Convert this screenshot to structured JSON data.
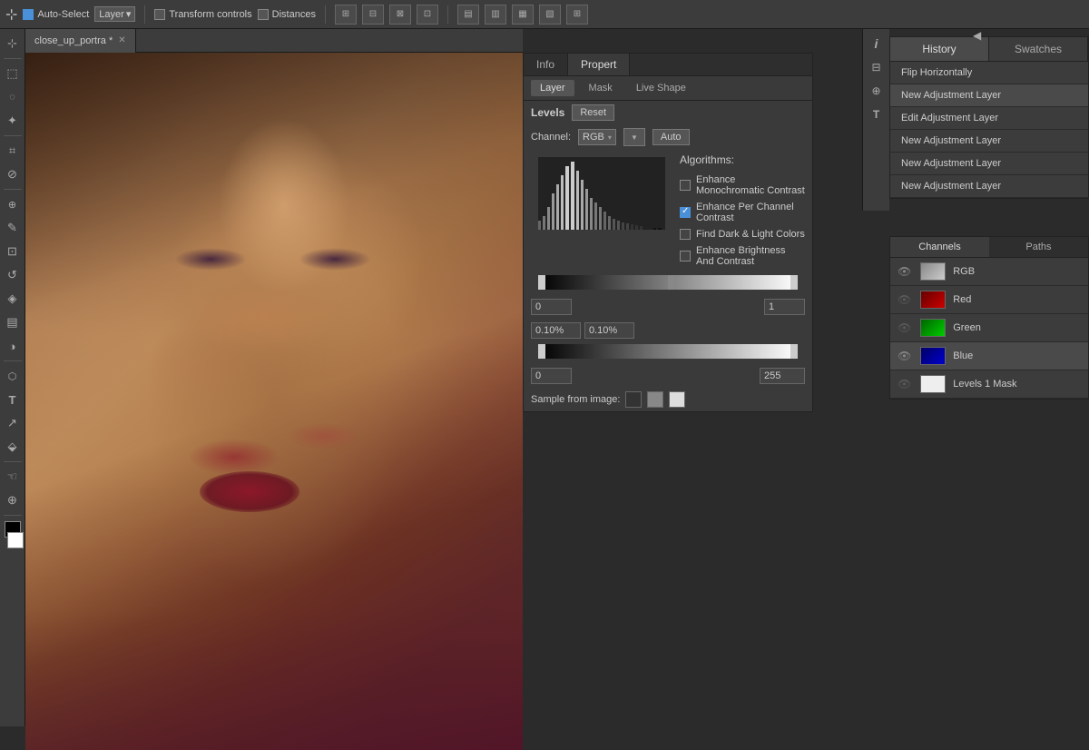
{
  "toolbar": {
    "auto_select_label": "Auto-Select",
    "auto_select_checked": true,
    "layer_label": "Layer",
    "transform_controls_label": "Transform controls",
    "transform_checked": false,
    "distances_label": "Distances",
    "distances_checked": false
  },
  "document_tab": {
    "name": "close_up_portra",
    "display": "close_up_portra *",
    "modified": true
  },
  "properties_panel": {
    "tabs": [
      "Info",
      "Propert"
    ],
    "active_tab": "Propert",
    "subtabs": [
      "Layer",
      "Mask",
      "Live Shape"
    ],
    "active_subtab": "Layer",
    "levels_label": "Levels",
    "reset_label": "Reset",
    "channel_label": "Channel:",
    "channel_value": "RGB",
    "auto_label": "Auto",
    "algorithms_title": "Algorithms:",
    "algorithms": [
      {
        "label": "Enhance Monochromatic Contrast",
        "checked": false
      },
      {
        "label": "Enhance Per Channel Contrast",
        "checked": true
      },
      {
        "label": "Find Dark & Light Colors",
        "checked": false
      },
      {
        "label": "Enhance Brightness And Contrast",
        "checked": false
      }
    ],
    "percent1": "0.10%",
    "percent2": "0.10%",
    "output_min": "0",
    "output_max": "255",
    "input_min": "0",
    "input_max": "1",
    "sample_label": "Sample from image:"
  },
  "history_panel": {
    "tabs": [
      "History",
      "Swatches"
    ],
    "active_tab": "History",
    "items": [
      {
        "label": "Flip Horizontally"
      },
      {
        "label": "New Adjustment Layer"
      },
      {
        "label": "Edit Adjustment Layer"
      },
      {
        "label": "New Adjustment Layer"
      },
      {
        "label": "New Adjustment Layer"
      },
      {
        "label": "New Adjustment Layer"
      }
    ]
  },
  "channels_panel": {
    "tabs": [
      "Channels",
      "Paths"
    ],
    "active_tab": "Channels",
    "items": [
      {
        "label": "RGB",
        "type": "rgb"
      },
      {
        "label": "Red",
        "type": "red"
      },
      {
        "label": "Green",
        "type": "green"
      },
      {
        "label": "Blue",
        "type": "blue"
      },
      {
        "label": "Levels 1 Mask",
        "type": "mask"
      }
    ]
  },
  "tools": [
    {
      "icon": "⊕",
      "name": "move-tool"
    },
    {
      "icon": "⬚",
      "name": "marquee-tool"
    },
    {
      "icon": "⌖",
      "name": "lasso-tool"
    },
    {
      "icon": "✦",
      "name": "quick-select-tool"
    },
    {
      "icon": "✂",
      "name": "crop-tool"
    },
    {
      "icon": "⊘",
      "name": "eyedropper-tool"
    },
    {
      "icon": "✎",
      "name": "healing-tool"
    },
    {
      "icon": "⊡",
      "name": "brush-tool"
    },
    {
      "icon": "⊟",
      "name": "clone-tool"
    },
    {
      "icon": "⊞",
      "name": "history-brush-tool"
    },
    {
      "icon": "◈",
      "name": "eraser-tool"
    },
    {
      "icon": "▤",
      "name": "gradient-tool"
    },
    {
      "icon": "◑",
      "name": "dodge-tool"
    },
    {
      "icon": "⬡",
      "name": "pen-tool"
    },
    {
      "icon": "T",
      "name": "type-tool"
    },
    {
      "icon": "↗",
      "name": "path-select-tool"
    },
    {
      "icon": "⬙",
      "name": "shape-tool"
    },
    {
      "icon": "☜",
      "name": "hand-tool"
    },
    {
      "icon": "⊕",
      "name": "zoom-tool"
    }
  ],
  "colors": {
    "bg": "#2b2b2b",
    "panel_bg": "#3c3c3c",
    "dark_bg": "#2e2e2e",
    "accent_blue": "#4a90d9",
    "border": "#222222",
    "text_light": "#cccccc",
    "text_dim": "#aaaaaa"
  }
}
